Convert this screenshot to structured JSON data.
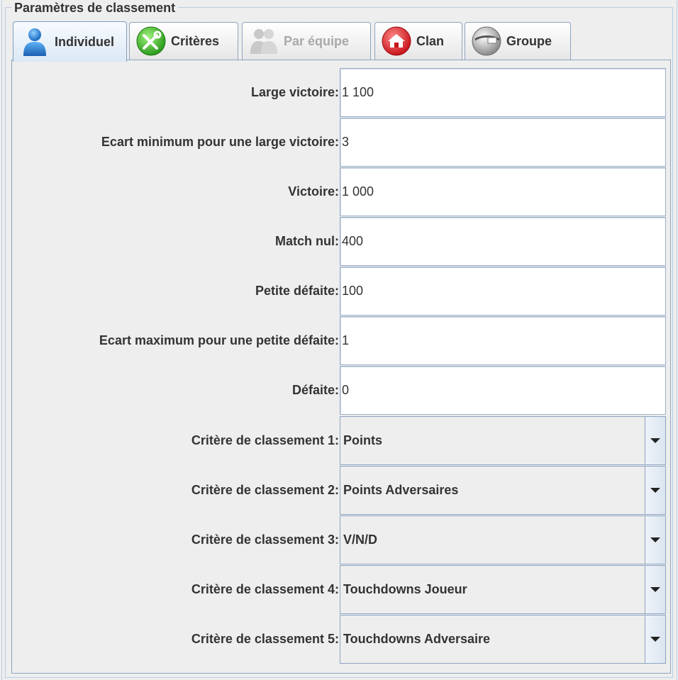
{
  "group_title": "Paramètres de classement",
  "tabs": [
    {
      "label": "Individuel",
      "icon": "user-icon",
      "selected": true,
      "enabled": true
    },
    {
      "label": "Critères",
      "icon": "tools-icon",
      "selected": false,
      "enabled": true
    },
    {
      "label": "Par équipe",
      "icon": "team-icon",
      "selected": false,
      "enabled": false
    },
    {
      "label": "Clan",
      "icon": "house-icon",
      "selected": false,
      "enabled": true
    },
    {
      "label": "Groupe",
      "icon": "group-disc-icon",
      "selected": false,
      "enabled": true
    }
  ],
  "fields": [
    {
      "label": "Large victoire:",
      "value": "1 100"
    },
    {
      "label": "Ecart minimum pour une large victoire:",
      "value": "3"
    },
    {
      "label": "Victoire:",
      "value": "1 000"
    },
    {
      "label": "Match nul:",
      "value": "400"
    },
    {
      "label": "Petite défaite:",
      "value": "100"
    },
    {
      "label": "Ecart maximum pour une petite défaite:",
      "value": "1"
    },
    {
      "label": "Défaite:",
      "value": "0"
    }
  ],
  "criteria": [
    {
      "label": "Critère de classement 1:",
      "value": "Points"
    },
    {
      "label": "Critère de classement 2:",
      "value": "Points Adversaires"
    },
    {
      "label": "Critère de classement 3:",
      "value": "V/N/D"
    },
    {
      "label": "Critère de classement 4:",
      "value": "Touchdowns Joueur"
    },
    {
      "label": "Critère de classement 5:",
      "value": "Touchdowns Adversaire"
    }
  ],
  "colors": {
    "border": "#8da5c0",
    "background": "#eeeeee",
    "text": "#333333",
    "disabled_text": "#a9a9a9"
  }
}
